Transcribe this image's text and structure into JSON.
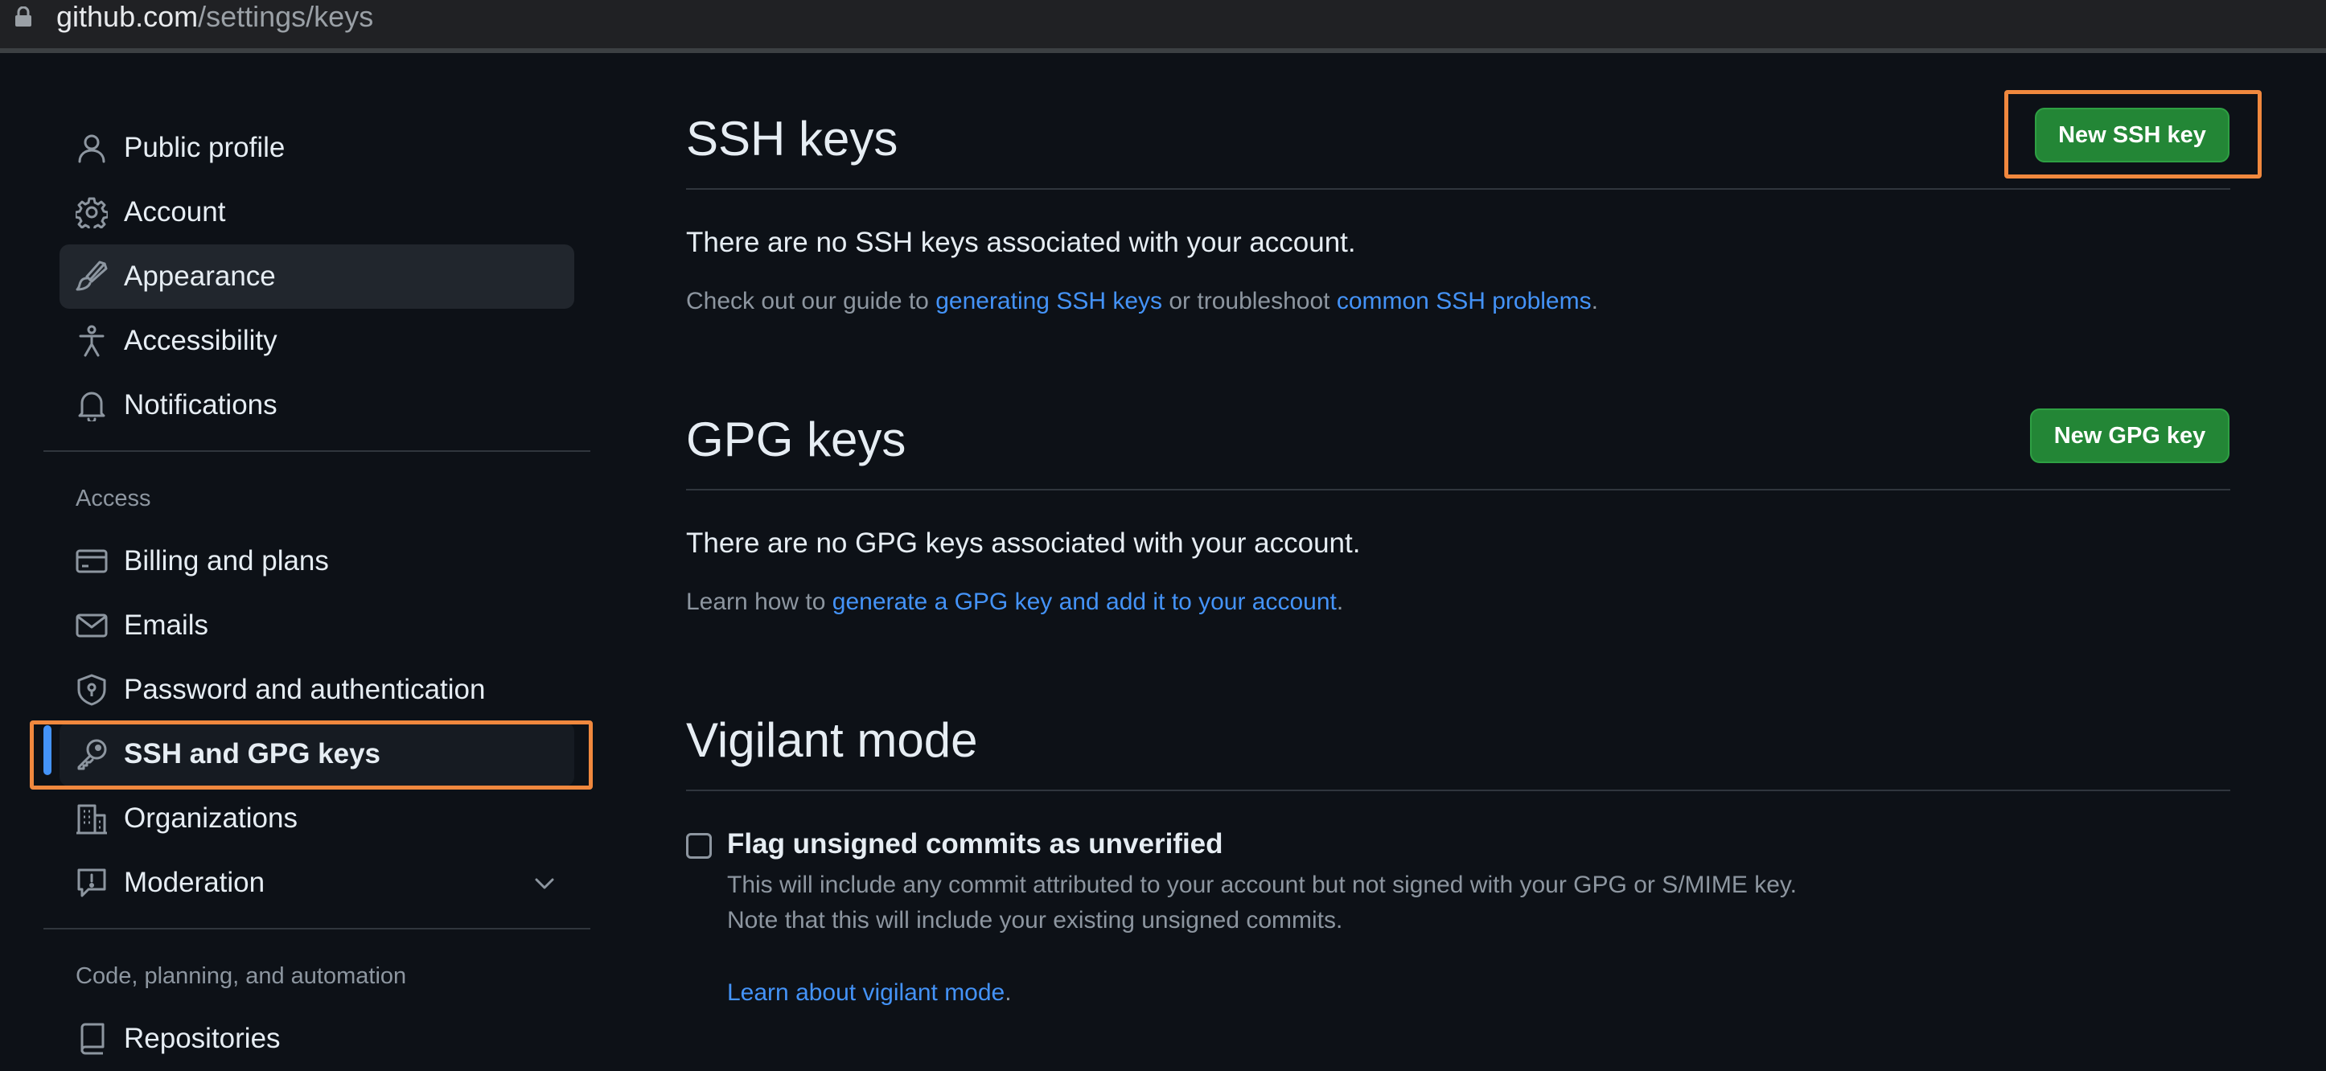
{
  "address_bar": {
    "host": "github.com",
    "path": "/settings/keys"
  },
  "sidebar": {
    "items": [
      {
        "label": "Public profile",
        "icon": "person-icon"
      },
      {
        "label": "Account",
        "icon": "gear-icon"
      },
      {
        "label": "Appearance",
        "icon": "paintbrush-icon"
      },
      {
        "label": "Accessibility",
        "icon": "accessibility-icon"
      },
      {
        "label": "Notifications",
        "icon": "bell-icon"
      }
    ],
    "access_heading": "Access",
    "access_items": [
      {
        "label": "Billing and plans",
        "icon": "credit-card-icon"
      },
      {
        "label": "Emails",
        "icon": "mail-icon"
      },
      {
        "label": "Password and authentication",
        "icon": "shield-lock-icon"
      },
      {
        "label": "SSH and GPG keys",
        "icon": "key-icon",
        "selected": true
      },
      {
        "label": "Organizations",
        "icon": "organization-icon"
      },
      {
        "label": "Moderation",
        "icon": "report-icon",
        "expandable": true
      }
    ],
    "code_heading": "Code, planning, and automation",
    "code_items": [
      {
        "label": "Repositories",
        "icon": "repo-icon"
      }
    ]
  },
  "ssh": {
    "title": "SSH keys",
    "new_button": "New SSH key",
    "empty_text": "There are no SSH keys associated with your account.",
    "guide_prefix": "Check out our guide to ",
    "guide_link": "generating SSH keys",
    "guide_middle": " or troubleshoot ",
    "troubleshoot_link": "common SSH problems",
    "guide_suffix": "."
  },
  "gpg": {
    "title": "GPG keys",
    "new_button": "New GPG key",
    "empty_text": "There are no GPG keys associated with your account.",
    "learn_prefix": "Learn how to ",
    "learn_link": "generate a GPG key and add it to your account",
    "learn_suffix": "."
  },
  "vigilant": {
    "title": "Vigilant mode",
    "checkbox_label": "Flag unsigned commits as unverified",
    "checked": false,
    "note_line1": "This will include any commit attributed to your account but not signed with your GPG or S/MIME key.",
    "note_line2": "Note that this will include your existing unsigned commits.",
    "learn_link": "Learn about vigilant mode",
    "learn_suffix": "."
  },
  "colors": {
    "background": "#0d1117",
    "accent_link": "#4493f8",
    "primary_button": "#238636",
    "highlight": "#f0883e",
    "selected_bar": "#4493f8"
  }
}
